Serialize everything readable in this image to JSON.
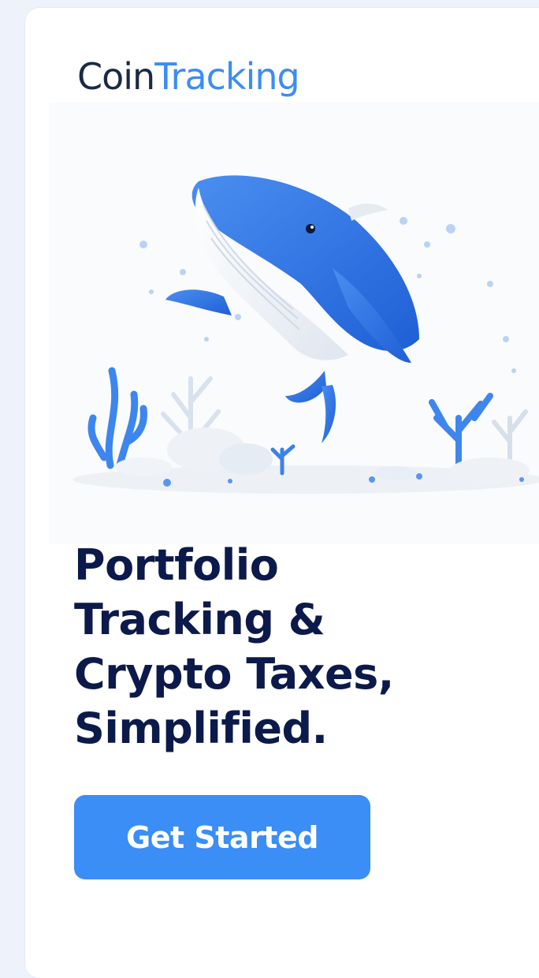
{
  "brand": {
    "logo_part1": "Coin",
    "logo_part2": "Tracking"
  },
  "hero": {
    "illustration": "blue-whale-underwater-illustration"
  },
  "headline": {
    "line1": "Portfolio",
    "line2": "Tracking &",
    "line3": "Crypto Taxes,",
    "line4": "Simplified."
  },
  "cta": {
    "label": "Get Started"
  },
  "colors": {
    "accent": "#3a8ef5",
    "headline": "#0b1a4a",
    "logo_dark": "#1b2a44",
    "logo_blue": "#3b8df4"
  }
}
